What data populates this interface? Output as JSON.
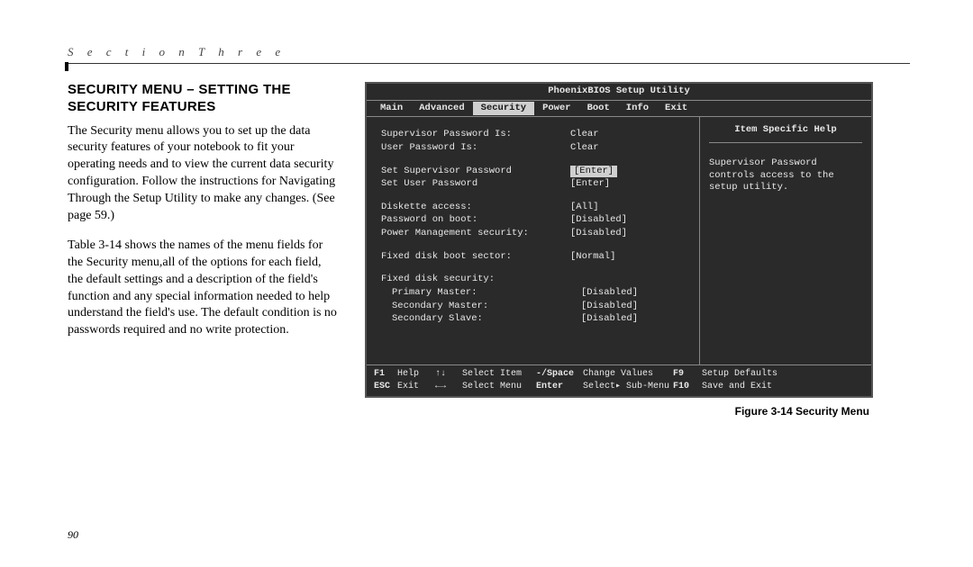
{
  "section_header": "S e c t i o n   T h r e e",
  "heading": "SECURITY MENU – SETTING THE SECURITY FEATURES",
  "paragraphs": [
    "The Security menu allows you to set up the data security features of your notebook to fit your operating needs and to view the current data security configuration. Follow the instructions for Navigating Through the Setup Utility to make any changes. (See page 59.)",
    "Table 3-14 shows the names of the menu fields for the Security menu,all of the options for each field, the default settings and a description of the field's function and any special information needed to help understand the field's use. The default condition is no passwords required and no write protection."
  ],
  "page_number": "90",
  "bios": {
    "title": "PhoenixBIOS Setup Utility",
    "tabs": [
      "Main",
      "Advanced",
      "Security",
      "Power",
      "Boot",
      "Info",
      "Exit"
    ],
    "active_tab": "Security",
    "help_title": "Item Specific Help",
    "help_text": "Supervisor Password controls access to the setup utility.",
    "rows": [
      {
        "label": "Supervisor Password Is:",
        "value": "Clear"
      },
      {
        "label": "User Password Is:",
        "value": "Clear"
      },
      "spacer",
      {
        "label": "Set Supervisor Password",
        "value": "[Enter]",
        "highlight": true
      },
      {
        "label": "Set User Password",
        "value": "[Enter]"
      },
      "spacer",
      {
        "label": "Diskette access:",
        "value": "[All]"
      },
      {
        "label": "Password on boot:",
        "value": "[Disabled]"
      },
      {
        "label": "Power Management security:",
        "value": "[Disabled]"
      },
      "spacer",
      {
        "label": "Fixed disk boot sector:",
        "value": "[Normal]"
      },
      "spacer",
      {
        "label": "Fixed disk security:",
        "value": ""
      },
      {
        "label": "Primary Master:",
        "value": "[Disabled]",
        "indent": true
      },
      {
        "label": "Secondary Master:",
        "value": "[Disabled]",
        "indent": true
      },
      {
        "label": "Secondary Slave:",
        "value": "[Disabled]",
        "indent": true
      }
    ],
    "footer": {
      "r1": {
        "k1": "F1",
        "a1": "Help",
        "k2": "↑↓",
        "a2": "Select Item",
        "k3": "-/Space",
        "a3": "Change Values",
        "k4": "F9",
        "a4": "Setup Defaults"
      },
      "r2": {
        "k1": "ESC",
        "a1": "Exit",
        "k2": "←→",
        "a2": "Select Menu",
        "k3": "Enter",
        "a3": "Select▸ Sub-Menu",
        "k4": "F10",
        "a4": "Save and Exit"
      }
    }
  },
  "figure_caption": "Figure 3-14 Security Menu"
}
